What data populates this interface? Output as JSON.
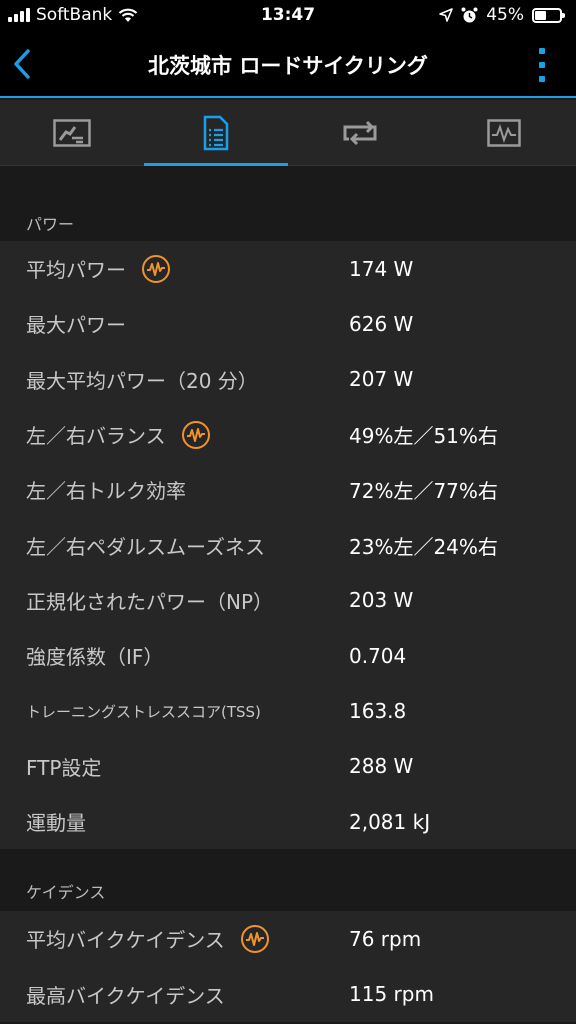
{
  "status_bar": {
    "carrier": "SoftBank",
    "time": "13:47",
    "battery_percent": "45%",
    "battery_level": 0.45
  },
  "header": {
    "title": "北茨城市 ロードサイクリング"
  },
  "tabs": [
    {
      "icon": "gauge-icon",
      "active": false
    },
    {
      "icon": "document-list-icon",
      "active": true
    },
    {
      "icon": "loop-icon",
      "active": false
    },
    {
      "icon": "chart-icon",
      "active": false
    }
  ],
  "sections": {
    "power": {
      "title": "パワー",
      "rows": [
        {
          "label": "平均パワー",
          "value": "174 W",
          "has_icon": true
        },
        {
          "label": "最大パワー",
          "value": "626 W",
          "has_icon": false
        },
        {
          "label": "最大平均パワー（20 分）",
          "value": "207 W",
          "has_icon": false
        },
        {
          "label": "左／右バランス",
          "value": "49%左／51%右",
          "has_icon": true
        },
        {
          "label": "左／右トルク効率",
          "value": "72%左／77%右",
          "has_icon": false
        },
        {
          "label": "左／右ペダルスムーズネス",
          "value": "23%左／24%右",
          "has_icon": false
        },
        {
          "label": "正規化されたパワー（NP）",
          "value": "203 W",
          "has_icon": false
        },
        {
          "label": "強度係数（IF）",
          "value": "0.704",
          "has_icon": false
        },
        {
          "label": "トレーニングストレススコア(TSS)",
          "value": "163.8",
          "has_icon": false,
          "small": true
        },
        {
          "label": "FTP設定",
          "value": "288 W",
          "has_icon": false
        },
        {
          "label": "運動量",
          "value": "2,081 kJ",
          "has_icon": false
        }
      ]
    },
    "cadence": {
      "title": "ケイデンス",
      "rows": [
        {
          "label": "平均バイクケイデンス",
          "value": "76 rpm",
          "has_icon": true
        },
        {
          "label": "最高バイクケイデンス",
          "value": "115 rpm",
          "has_icon": false
        }
      ]
    }
  },
  "colors": {
    "accent": "#1aa0e6",
    "power_icon": "#f0932a",
    "background": "#1a1a1a",
    "row_background": "#262626"
  }
}
